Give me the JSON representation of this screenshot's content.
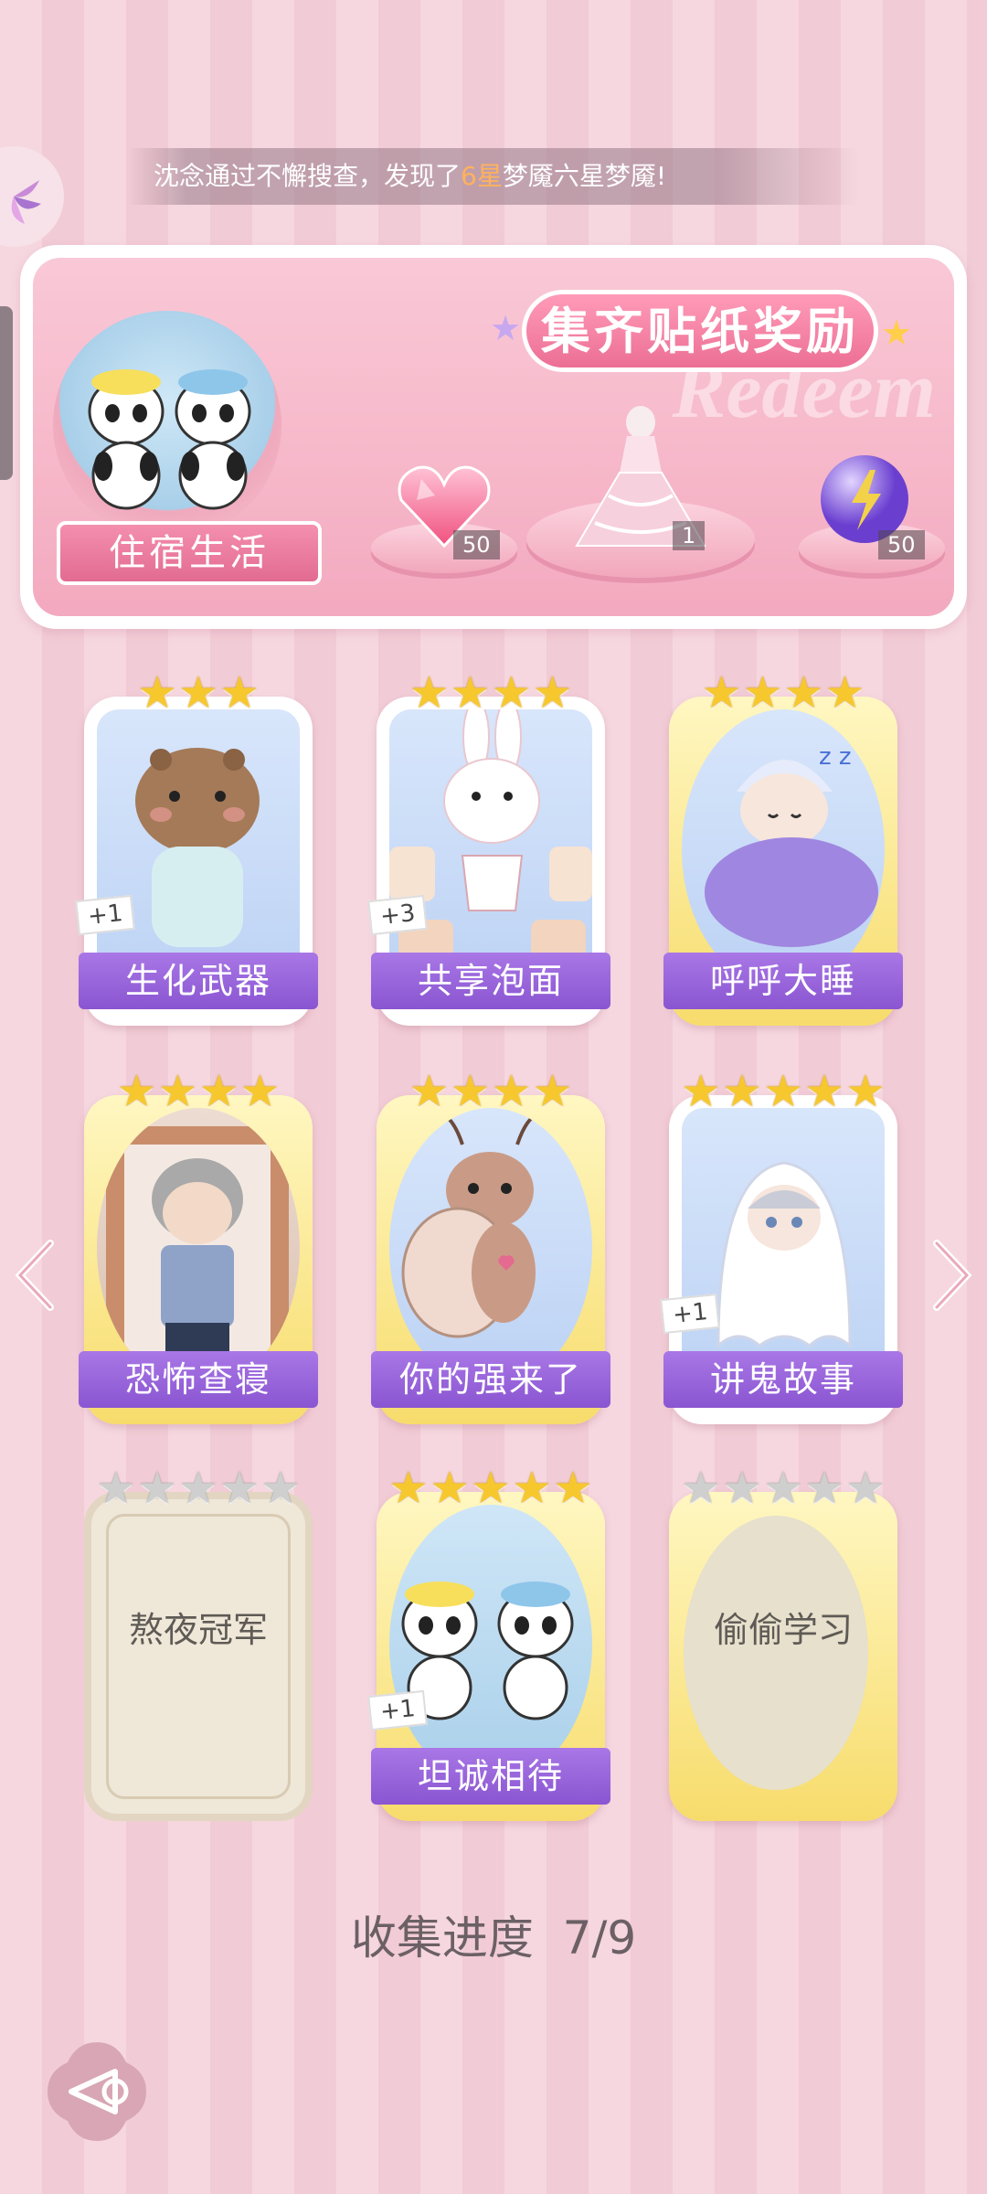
{
  "ticker": {
    "prefix": "沈念通过不懈搜查，发现了",
    "highlight": "6星",
    "suffix": "梦魇六星梦魇!"
  },
  "reward_panel": {
    "title": "集齐贴纸奖励",
    "watermark": "Redeem",
    "collection_name": "住宿生活",
    "rewards": [
      {
        "icon": "heart-gem-icon",
        "count": "50"
      },
      {
        "icon": "gown-outfit-icon",
        "count": "1"
      },
      {
        "icon": "lightning-orb-icon",
        "count": "50"
      }
    ]
  },
  "cards": [
    {
      "name": "生化武器",
      "stars": 3,
      "frame": "white",
      "dup": "+1",
      "icon": "capybara-icon",
      "owned": true
    },
    {
      "name": "共享泡面",
      "stars": 4,
      "frame": "white",
      "dup": "+3",
      "icon": "bunny-noodles-icon",
      "owned": true
    },
    {
      "name": "呼呼大睡",
      "stars": 4,
      "frame": "gold",
      "dup": "",
      "icon": "sleeping-boy-icon",
      "owned": true
    },
    {
      "name": "恐怖查寝",
      "stars": 4,
      "frame": "gold",
      "dup": "",
      "icon": "dorm-inspector-icon",
      "owned": true
    },
    {
      "name": "你的强来了",
      "stars": 4,
      "frame": "gold",
      "dup": "",
      "icon": "cockroach-icon",
      "owned": true
    },
    {
      "name": "讲鬼故事",
      "stars": 5,
      "frame": "white",
      "dup": "+1",
      "icon": "ghost-boy-icon",
      "owned": true
    },
    {
      "name": "熬夜冠军",
      "stars": 5,
      "frame": "locked",
      "dup": "",
      "icon": "",
      "owned": false
    },
    {
      "name": "坦诚相待",
      "stars": 5,
      "frame": "gold",
      "dup": "+1",
      "icon": "bathing-pandas-icon",
      "owned": true
    },
    {
      "name": "偷偷学习",
      "stars": 5,
      "frame": "locked-gold",
      "dup": "",
      "icon": "",
      "owned": false
    }
  ],
  "progress": {
    "label": "收集进度",
    "value": "7/9"
  },
  "colors": {
    "accent_purple": "#8a55d1",
    "accent_pink": "#ec6f95",
    "star_gold": "#f7c82e"
  }
}
